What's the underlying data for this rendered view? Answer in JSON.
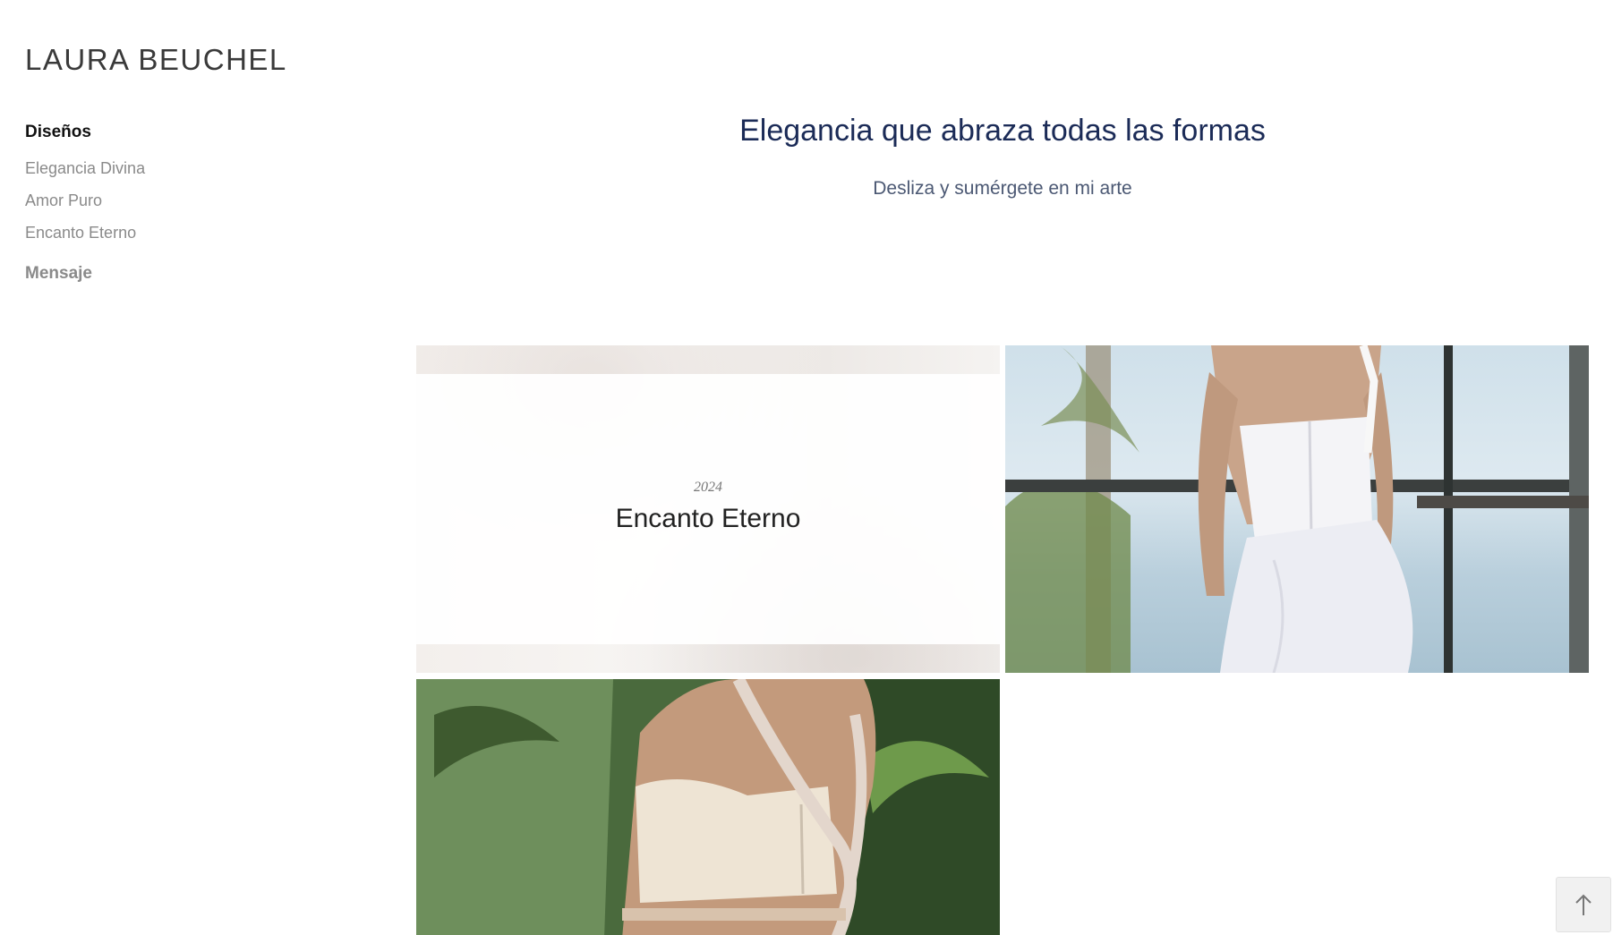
{
  "brand": {
    "logo_text": "LAURA BEUCHEL"
  },
  "nav": {
    "section_title": "Diseños",
    "items": [
      {
        "label": "Elegancia Divina"
      },
      {
        "label": "Amor Puro"
      },
      {
        "label": "Encanto Eterno"
      }
    ],
    "contact_label": "Mensaje"
  },
  "hero": {
    "title": "Elegancia que abraza todas las formas",
    "subtitle": "Desliza y sumérgete en mi arte"
  },
  "gallery": {
    "featured": {
      "year": "2024",
      "name": "Encanto Eterno"
    }
  },
  "colors": {
    "title": "#1b2b57",
    "subtitle": "#4b5873",
    "nav_muted": "#8a8a8a",
    "nav_active": "#111111"
  },
  "icons": {
    "back_to_top": "arrow-up-icon"
  }
}
